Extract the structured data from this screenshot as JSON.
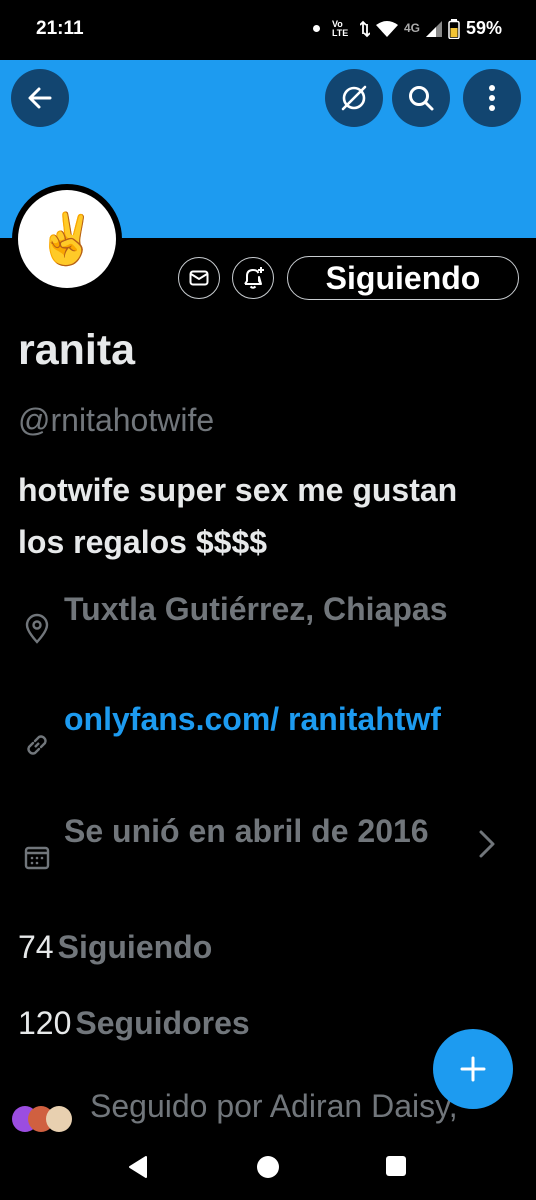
{
  "status_bar": {
    "time": "21:11",
    "volte": "Vo LTE",
    "network": "4G",
    "battery": "59%"
  },
  "header": {
    "back_icon": "arrow-left-icon",
    "grok_icon": "grok-icon",
    "search_icon": "search-icon",
    "more_icon": "more-vertical-icon",
    "banner_color": "#1d9bf0"
  },
  "profile": {
    "avatar_emoji": "✌️",
    "name": "ranita",
    "handle": "@rnitahotwife",
    "bio": "hotwife super sex me gustan los regalos $$$$",
    "location": "Tuxtla Gutiérrez, Chiapas",
    "website": "onlyfans.com/ ranitahtwf",
    "joined": "Se unió en abril de 2016"
  },
  "actions": {
    "message_icon": "mail-icon",
    "notify_icon": "bell-plus-icon",
    "follow_label": "Siguiendo"
  },
  "stats": {
    "following_count": "74",
    "following_label": "Siguiendo",
    "followers_count": "120",
    "followers_label": "Seguidores"
  },
  "followed_by": {
    "text": "Seguido por Adiran Daisy,"
  },
  "fab": {
    "icon": "plus-icon"
  },
  "nav": {
    "back_icon": "triangle-back-icon",
    "home_icon": "circle-home-icon",
    "recents_icon": "square-recents-icon"
  },
  "colors": {
    "accent": "#1d9bf0",
    "background": "#000000",
    "secondary_text": "#71767b",
    "primary_text": "#e7e9ea"
  }
}
